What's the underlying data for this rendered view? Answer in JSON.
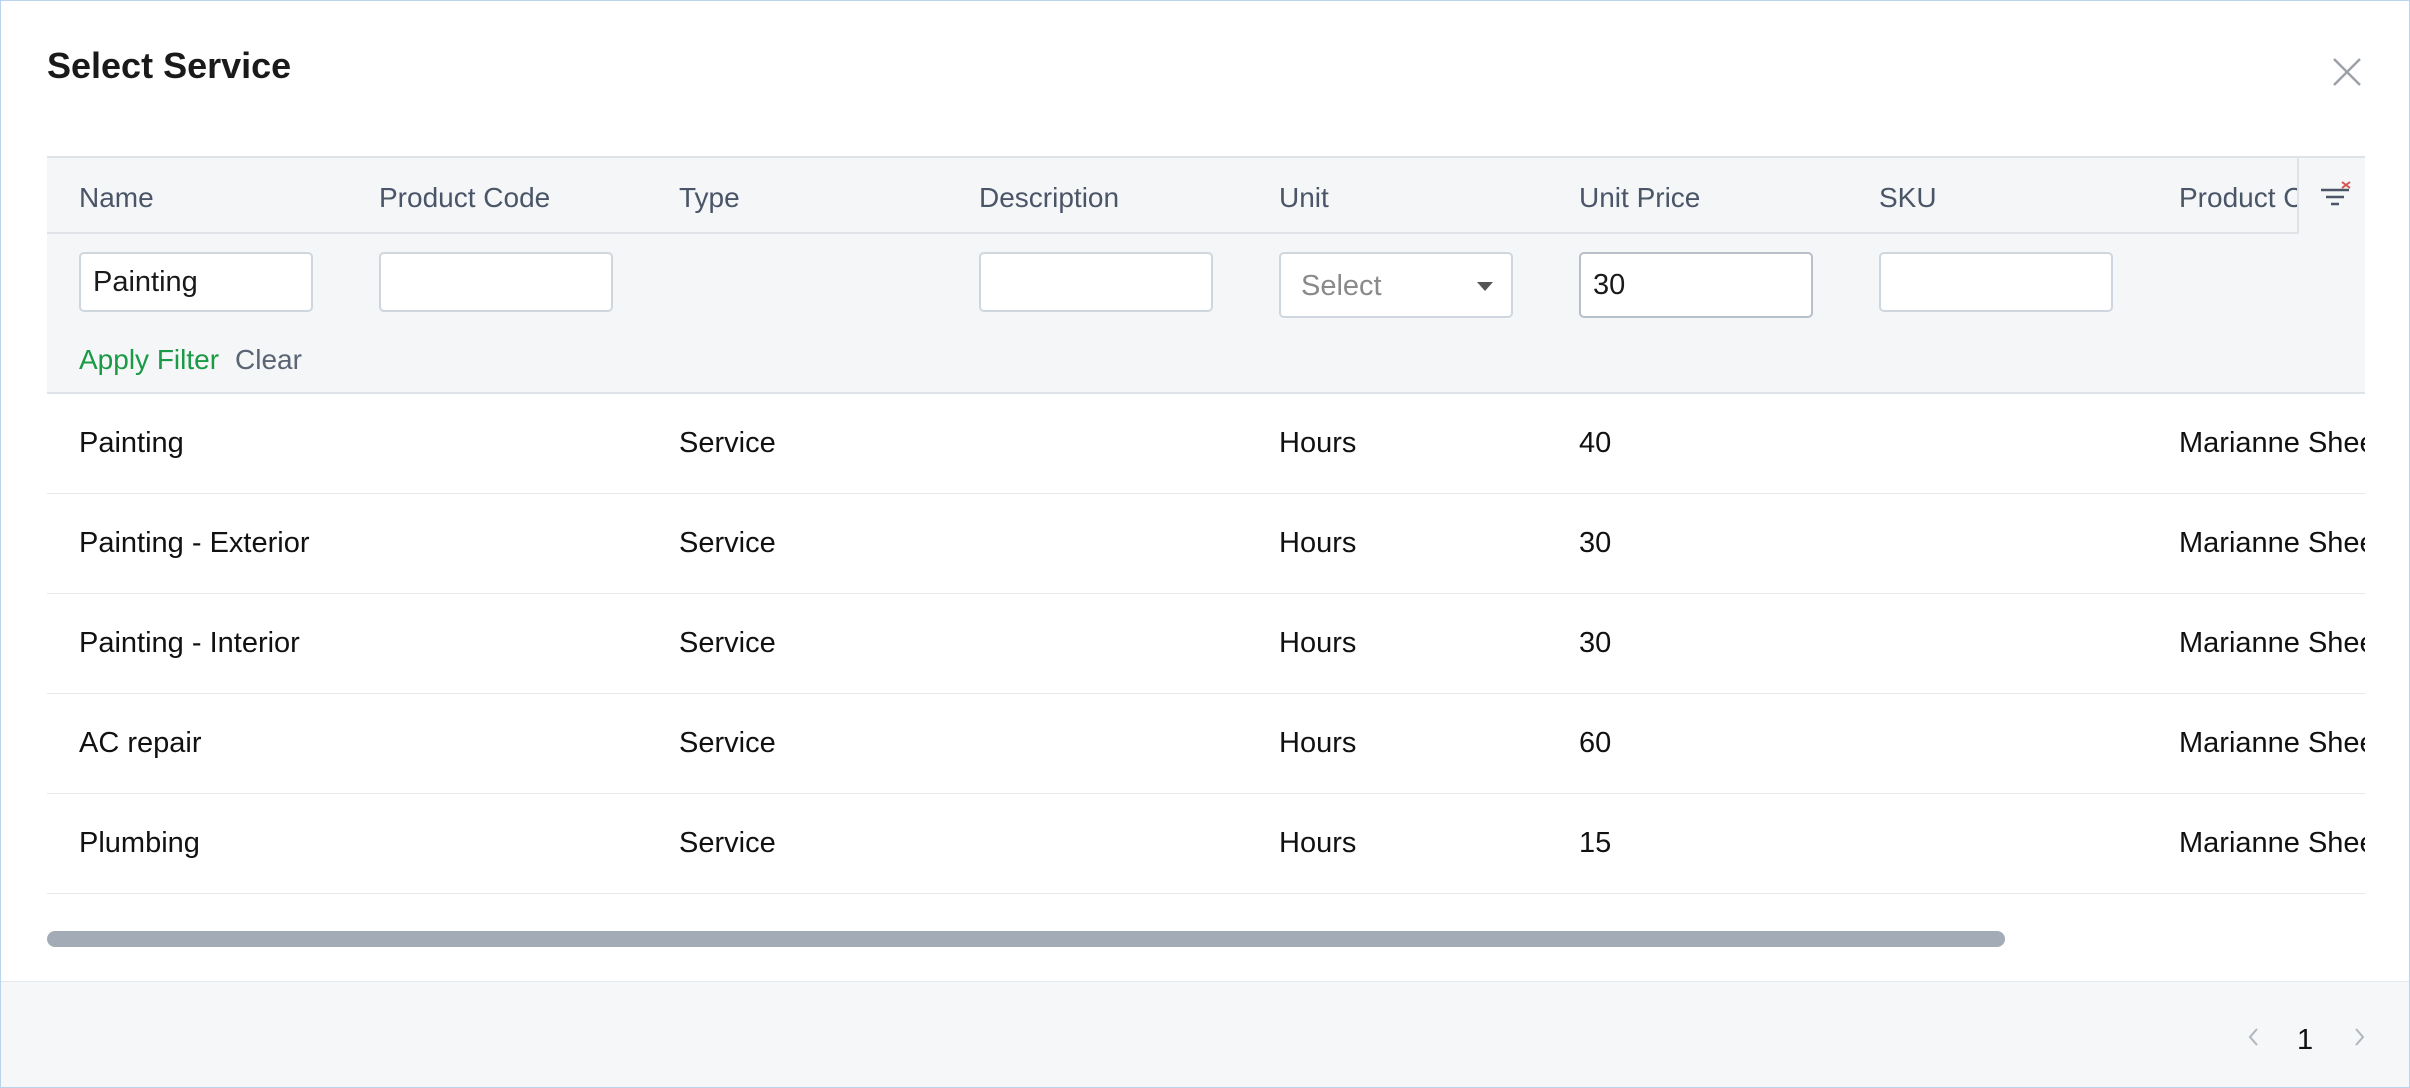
{
  "dialog": {
    "title": "Select Service"
  },
  "columns": [
    "Name",
    "Product Code",
    "Type",
    "Description",
    "Unit",
    "Unit Price",
    "SKU",
    "Product C"
  ],
  "filters": {
    "name_value": "Painting",
    "product_code_value": "",
    "description_value": "",
    "unit_placeholder": "Select",
    "unit_price_value": "30",
    "sku_value": "",
    "apply_label": "Apply Filter",
    "clear_label": "Clear"
  },
  "rows": [
    {
      "name": "Painting",
      "type": "Service",
      "unit": "Hours",
      "unit_price": "40",
      "product_owner": "Marianne Sheel"
    },
    {
      "name": "Painting - Exterior",
      "type": "Service",
      "unit": "Hours",
      "unit_price": "30",
      "product_owner": "Marianne Sheel"
    },
    {
      "name": "Painting - Interior",
      "type": "Service",
      "unit": "Hours",
      "unit_price": "30",
      "product_owner": "Marianne Sheel"
    },
    {
      "name": "AC repair",
      "type": "Service",
      "unit": "Hours",
      "unit_price": "60",
      "product_owner": "Marianne Sheel"
    },
    {
      "name": "Plumbing",
      "type": "Service",
      "unit": "Hours",
      "unit_price": "15",
      "product_owner": "Marianne Sheel"
    }
  ],
  "pagination": {
    "current_page": "1"
  },
  "icons": {
    "close": "close-icon",
    "filter": "filter-settings-icon",
    "prev": "chevron-left-icon",
    "next": "chevron-right-icon"
  },
  "colors": {
    "accent_green": "#1a9a45",
    "header_bg": "#f4f6f8",
    "border": "#dfe3e8",
    "scrollbar": "#a3abb6"
  }
}
